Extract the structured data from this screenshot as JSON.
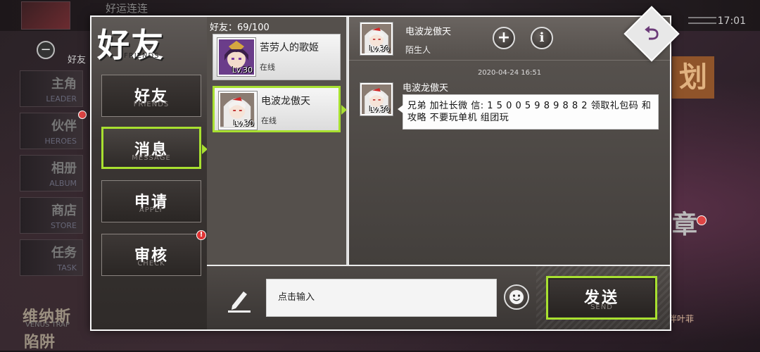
{
  "background": {
    "top_title": "好运连连",
    "time": "17:01",
    "friends_button_label": "好友",
    "side_menu": [
      {
        "cn": "主角",
        "en": "LEADER"
      },
      {
        "cn": "伙伴",
        "en": "HEROES"
      },
      {
        "cn": "相册",
        "en": "ALBUM"
      },
      {
        "cn": "商店",
        "en": "STORE"
      },
      {
        "cn": "任务",
        "en": "TASK"
      }
    ],
    "venus_title": "维纳斯",
    "venus_en": "VENUS TRAP",
    "venus_title2": "陷阱",
    "right_glyph_1": "划",
    "right_glyph_2": "章",
    "right_caption": "伴叶菲"
  },
  "dialog": {
    "title_cn": "好友",
    "title_en": "FRIENDS",
    "tabs": [
      {
        "cn": "好友",
        "en": "FRIENDS",
        "active": false,
        "badge": false
      },
      {
        "cn": "消息",
        "en": "MESSAGE",
        "active": true,
        "badge": false
      },
      {
        "cn": "申请",
        "en": "APPLY",
        "active": false,
        "badge": false
      },
      {
        "cn": "审核",
        "en": "CHECK",
        "active": false,
        "badge": true
      }
    ],
    "friend_count": "好友：69/100",
    "friends": [
      {
        "name": "苦劳人的歌姬",
        "level": "Lv.30",
        "status": "在线",
        "active": false
      },
      {
        "name": "电波龙傲天",
        "level": "Lv.30",
        "status": "在线",
        "active": true
      }
    ],
    "chat": {
      "header_name": "电波龙傲天",
      "header_relation": "陌生人",
      "header_level": "Lv.30",
      "timestamp": "2020-04-24 16:51",
      "messages": [
        {
          "sender": "电波龙傲天",
          "level": "Lv.30",
          "text": "兄弟 加社长微 信: 1 5 0 0 5 9 8 9 8 8 2 领取礼包码 和攻略 不要玩单机 组团玩"
        }
      ]
    },
    "input_placeholder": "点击输入",
    "send_cn": "发送",
    "send_en": "SEND"
  },
  "colors": {
    "accent_green": "#a8e030",
    "badge_red": "#e03434"
  },
  "icons": {
    "add_friend": "plus-icon",
    "info": "info-icon",
    "close": "back-arrow-icon",
    "pencil": "pencil-icon",
    "emoji": "smiley-icon"
  }
}
